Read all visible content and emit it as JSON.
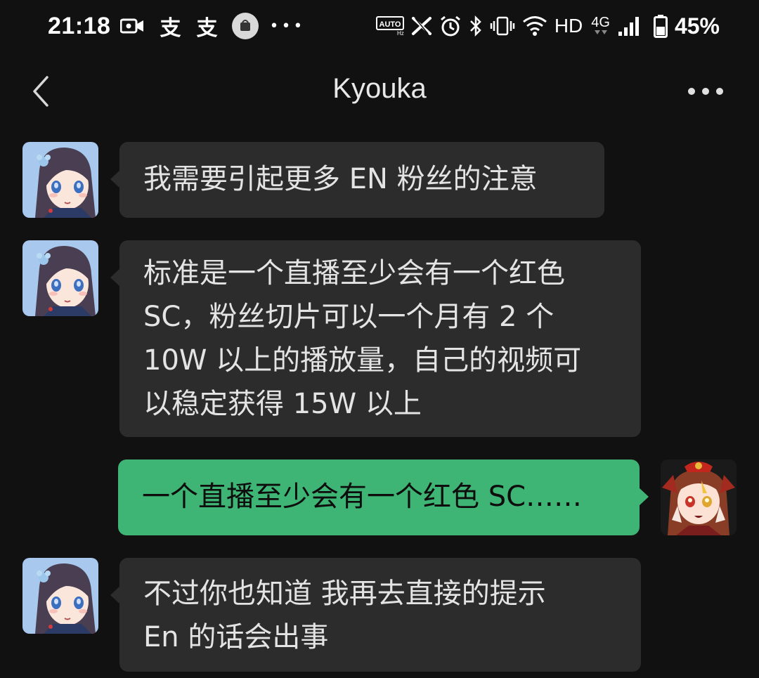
{
  "status_bar": {
    "time": "21:18",
    "network_label": "HD",
    "network_type": "4G",
    "battery_percent": "45%",
    "icons_left": [
      "video-camera-icon",
      "app-notification-icon",
      "app-notification-icon",
      "shopping-bag-icon",
      "more-notifications-icon"
    ],
    "icons_right": [
      "auto-refresh-rate-icon",
      "x-app-icon",
      "alarm-icon",
      "bluetooth-icon",
      "vibrate-icon",
      "wifi-icon",
      "signal-icon",
      "battery-icon"
    ],
    "notification_glyph": "支",
    "auto_label": "AUTO",
    "hz_label": "Hz"
  },
  "header": {
    "title": "Kyouka",
    "back_icon": "chevron-left-icon",
    "more_icon": "more-horizontal-icon"
  },
  "colors": {
    "background": "#111111",
    "incoming_bubble": "#2c2c2c",
    "outgoing_bubble": "#3eb575",
    "incoming_text": "#e4e4e4",
    "outgoing_text": "#0d0d0d"
  },
  "messages": [
    {
      "sender": "Kyouka",
      "direction": "incoming",
      "text": "我需要引起更多 EN 粉丝的注意"
    },
    {
      "sender": "Kyouka",
      "direction": "incoming",
      "lines": [
        "标准是一个直播至少会有一个红色",
        "SC，粉丝切片可以一个月有 2 个",
        "10W 以上的播放量，自己的视频可",
        "以稳定获得 15W 以上"
      ]
    },
    {
      "sender": "self",
      "direction": "outgoing",
      "text": "一个直播至少会有一个红色 SC……"
    },
    {
      "sender": "Kyouka",
      "direction": "incoming",
      "lines": [
        "不过你也知道 我再去直接的提示",
        "En 的话会出事"
      ]
    }
  ]
}
